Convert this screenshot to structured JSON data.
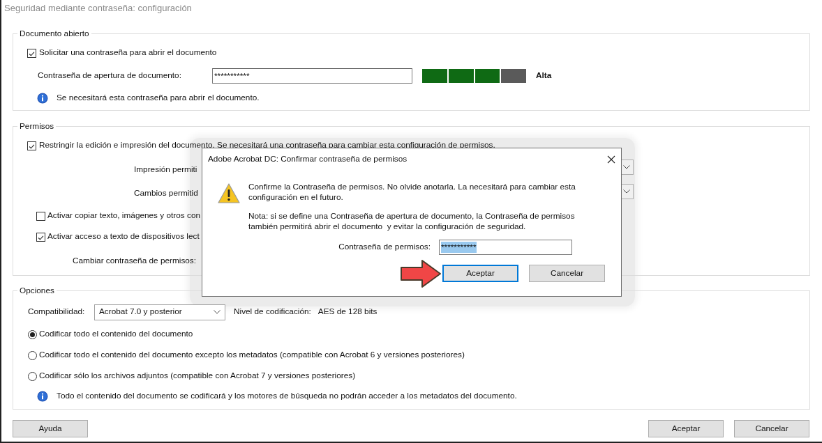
{
  "window": {
    "title": "Seguridad mediante contraseña: configuración"
  },
  "open_document": {
    "title": "Documento abierto",
    "require_password": {
      "label": "Solicitar una contraseña para abrir el documento",
      "checked": true
    },
    "password_label": "Contraseña de apertura de documento:",
    "password_value": "***********",
    "strength": {
      "level": 0.75,
      "reading": "Alta"
    },
    "info": "Se necesitará esta contraseña para abrir el documento."
  },
  "permissions": {
    "title": "Permisos",
    "restrict": {
      "label": "Restringir la edición e impresión del documento. Se necesitará una contraseña para cambiar esta configuración de permisos.",
      "checked": true
    },
    "printing_label": "Impresión permiti",
    "changes_label": "Cambios permitid",
    "copy_text": {
      "label": "Activar copiar texto, imágenes y otros con",
      "checked": false
    },
    "screen_reader": {
      "label": "Activar acceso a texto de dispositivos lect",
      "checked": true
    },
    "change_password_label": "Cambiar contraseña de permisos:"
  },
  "options": {
    "title": "Opciones",
    "compatibility_label": "Compatibilidad:",
    "compatibility_value": "Acrobat 7.0 y posterior",
    "encryption_label": "Nivel de codificación:",
    "encryption_value": "AES de 128 bits",
    "encrypt_modes": [
      {
        "label": "Codificar todo el contenido del documento",
        "selected": true
      },
      {
        "label": "Codificar todo el contenido del documento excepto los metadatos (compatible con Acrobat 6 y versiones posteriores)",
        "selected": false
      },
      {
        "label": "Codificar sólo los archivos adjuntos (compatible con Acrobat 7 y versiones posteriores)",
        "selected": false
      }
    ],
    "info": "Todo el contenido del documento se codificará y los motores de búsqueda no podrán acceder a los metadatos del documento."
  },
  "buttons": {
    "help": "Ayuda",
    "ok": "Aceptar",
    "cancel": "Cancelar"
  },
  "dialog": {
    "title": "Adobe Acrobat DC: Confirmar contraseña de permisos",
    "message": "Confirme la Contraseña de permisos. No olvide anotarla. La necesitará para cambiar esta configuración en el futuro.",
    "note": "Nota: si se define una Contraseña de apertura de documento, la Contraseña de permisos también permitirá abrir el documento  y evitar la configuración de seguridad.",
    "password_label": "Contraseña de permisos:",
    "password_value": "***********",
    "buttons": [
      {
        "label": "Aceptar",
        "focused": true
      },
      {
        "label": "Cancelar",
        "focused": false
      }
    ]
  }
}
